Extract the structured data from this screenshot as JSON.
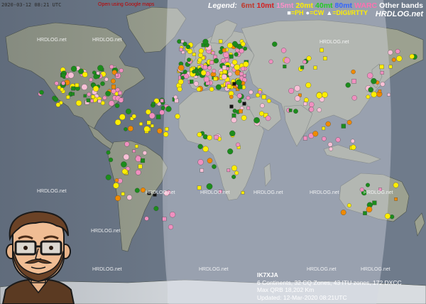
{
  "header": {
    "timestamp": "2020-03-12 08:21 UTC",
    "gmaps_link": "Open using Google maps"
  },
  "legend": {
    "label": "Legend:",
    "bands": [
      {
        "name": "6mt",
        "color": "#c0392b"
      },
      {
        "name": "10mt",
        "color": "#d42020"
      },
      {
        "name": "15mt",
        "color": "#ff8fc8"
      },
      {
        "name": "20mt",
        "color": "#ffee00"
      },
      {
        "name": "40mt",
        "color": "#22cc22"
      },
      {
        "name": "80mt",
        "color": "#3366ff"
      },
      {
        "name": "WARC",
        "color": "#ff6fb0"
      },
      {
        "name": "Other bands",
        "color": "#ffffff"
      }
    ],
    "modes": [
      {
        "symbol": "square",
        "label": "=PH"
      },
      {
        "symbol": "circle",
        "label": "=CW"
      },
      {
        "symbol": "triangle",
        "label": "=DIGI/RTTY"
      }
    ]
  },
  "brand": "HRDLOG.net",
  "watermark": "HRDLOG.net",
  "stats": {
    "callsign": "IK7XJA",
    "summary": "6 Continents, 32 CQ Zones, 43 ITU zones, 172 DXCC",
    "max_qrb": "Max QRB 18,202 Km",
    "updated": "Updated: 12-Mar-2020 08:21UTC"
  },
  "colors": {
    "ocean": "#6e7a8a",
    "land": "#9aa08e",
    "night_shade": "#1e2634",
    "day_band": "#c8cad6",
    "qso_yellow": "#ffee00",
    "qso_green": "#1c8c1c",
    "qso_pink": "#f090c0",
    "qso_lightpink": "#f7c0d6",
    "qso_orange": "#f08a00",
    "qso_black": "#111111"
  }
}
